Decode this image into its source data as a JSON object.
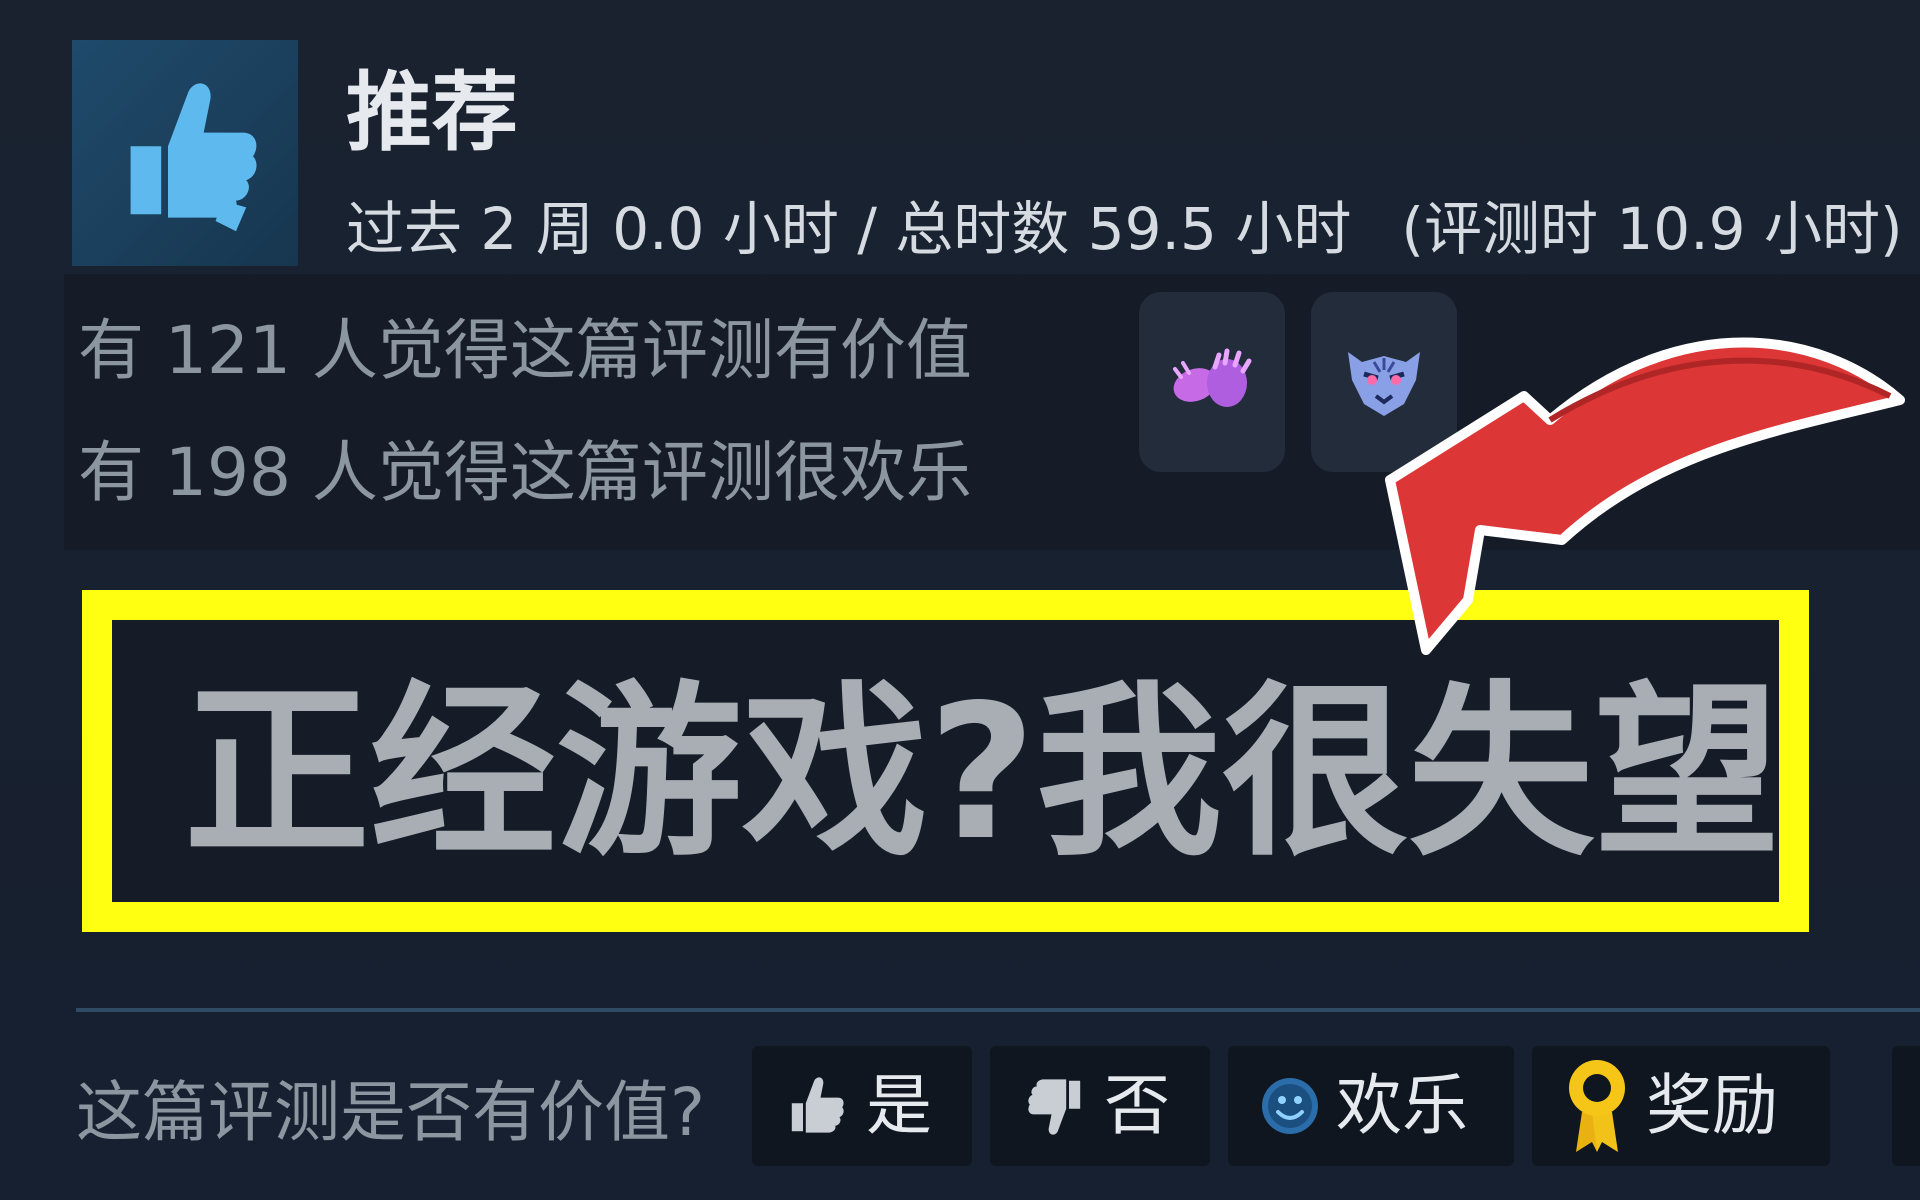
{
  "review": {
    "status": "推荐",
    "hours_recent": "过去 2 周 0.0 小时 / 总时数 59.5 小时",
    "hours_at_review": "(评测时 10.9 小时)"
  },
  "helpful": {
    "valuable_text": "有 121 人觉得这篇评测有价值",
    "funny_text": "有 198 人觉得这篇评测很欢乐"
  },
  "caption": {
    "text": "正经游戏?我很失望"
  },
  "vote": {
    "question": "这篇评测是否有价值?",
    "yes_label": "是",
    "no_label": "否",
    "funny_label": "欢乐",
    "award_label": "奖励"
  },
  "colors": {
    "highlight_border": "#ffff12",
    "arrow": "#e03a3a",
    "thumb_icon": "#5eb9ee"
  },
  "icons": [
    "thumbs-up-icon",
    "clapping-hands-icon",
    "tiger-icon",
    "thumbs-down-icon",
    "smiley-icon",
    "award-ribbon-icon"
  ]
}
